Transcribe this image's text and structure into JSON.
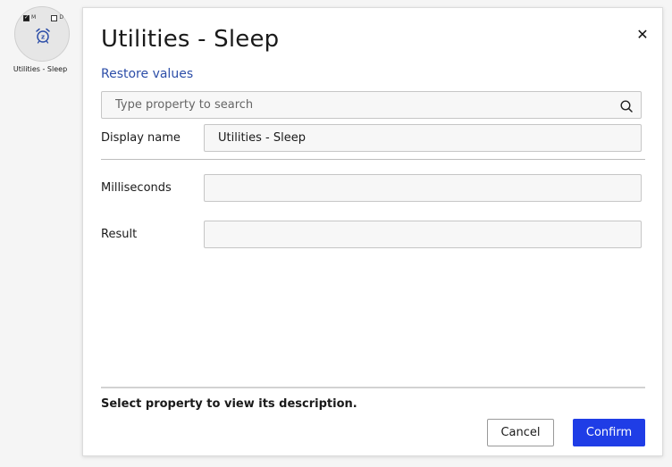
{
  "node": {
    "flag_m": "M",
    "flag_d": "D",
    "label": "Utilities - Sleep",
    "icon": "alarm-clock-sleep-icon",
    "icon_color": "#2d4ea8"
  },
  "dialog": {
    "title": "Utilities - Sleep",
    "close_icon": "close-icon",
    "restore_label": "Restore values",
    "search_placeholder": "Type property to search",
    "properties": {
      "display_name": {
        "label": "Display name",
        "value": "Utilities - Sleep"
      },
      "milliseconds": {
        "label": "Milliseconds",
        "value": ""
      },
      "result": {
        "label": "Result",
        "value": ""
      }
    },
    "description": "Select property to view its description.",
    "cancel_label": "Cancel",
    "confirm_label": "Confirm"
  },
  "colors": {
    "accent": "#1f3de6",
    "link": "#2d4ea8"
  }
}
